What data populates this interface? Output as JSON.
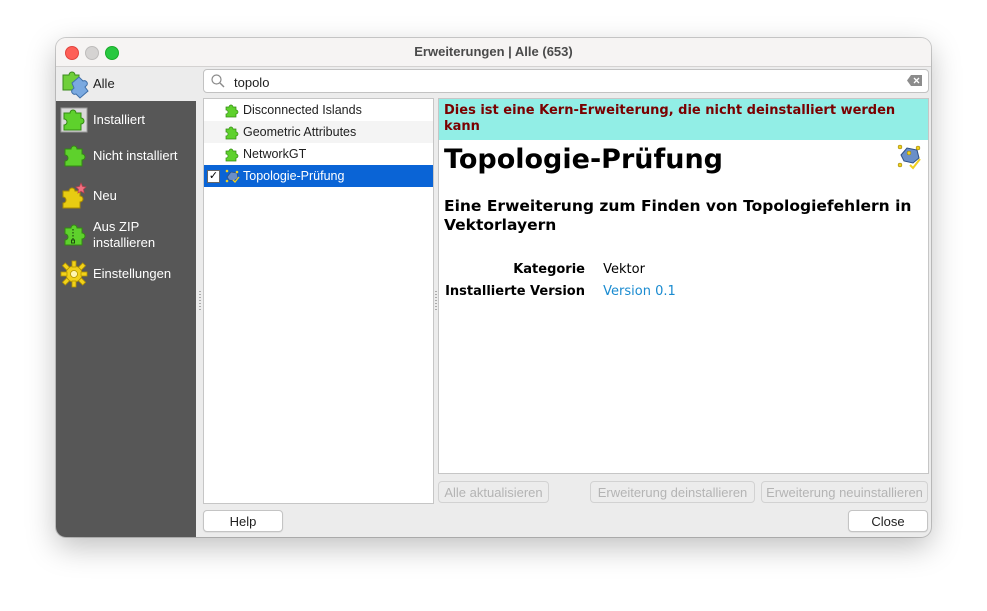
{
  "window": {
    "title": "Erweiterungen | Alle (653)"
  },
  "sidebar": {
    "items": [
      {
        "label": "Alle",
        "icon": "all-plugins-icon",
        "active": true
      },
      {
        "label": "Installiert",
        "icon": "installed-plugins-icon"
      },
      {
        "label": "Nicht installiert",
        "icon": "not-installed-plugins-icon"
      },
      {
        "label": "Neu",
        "icon": "new-plugins-icon"
      },
      {
        "label": "Aus ZIP installieren",
        "label_line1": "Aus ZIP",
        "label_line2": "installieren",
        "icon": "install-zip-icon"
      },
      {
        "label": "Einstellungen",
        "icon": "settings-gear-icon"
      }
    ]
  },
  "search": {
    "value": "topolo",
    "placeholder": ""
  },
  "plugin_list": {
    "items": [
      {
        "name": "Disconnected Islands",
        "checked": null
      },
      {
        "name": "Geometric Attributes",
        "checked": null
      },
      {
        "name": "NetworkGT",
        "checked": null
      },
      {
        "name": "Topologie-Prüfung",
        "checked": true,
        "selected": true
      }
    ],
    "check_mark": "✓"
  },
  "details": {
    "banner": "Dies ist eine Kern-Erweiterung, die nicht deinstalliert werden kann",
    "title": "Topologie-Prüfung",
    "description": "Eine Erweiterung zum Finden von Topologiefehlern in Vektorlayern",
    "fields": [
      {
        "key": "Kategorie",
        "value": "Vektor"
      },
      {
        "key": "Installierte Version",
        "value": "Version 0.1"
      }
    ],
    "colors": {
      "banner_bg": "#92eee6",
      "banner_text": "#7a0000",
      "link": "#1a8bd0",
      "selection": "#0a64d6"
    }
  },
  "buttons": {
    "upgrade_all": "Alle aktualisieren",
    "uninstall": "Erweiterung deinstallieren",
    "reinstall": "Erweiterung neuinstallieren",
    "help": "Help",
    "close": "Close"
  }
}
